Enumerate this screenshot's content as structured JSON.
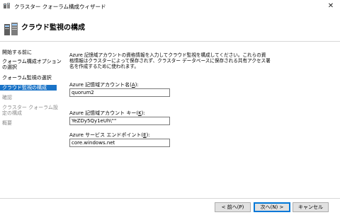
{
  "window": {
    "title": "クラスター クォーラム構成ウィザード",
    "close_glyph": "✕"
  },
  "banner": {
    "title": "クラウド監視の構成"
  },
  "nav": {
    "items": [
      {
        "label": "開始する前に",
        "state": "normal"
      },
      {
        "label": "クォーラム構成オプション",
        "label2": "の選択",
        "state": "normal"
      },
      {
        "label": "クォーラム監視の選択",
        "state": "normal"
      },
      {
        "label": "クラウド監視の構成",
        "state": "active"
      },
      {
        "label": "確認",
        "state": "disabled"
      },
      {
        "label": "クラスター クォーラム設",
        "label2": "定の構成",
        "state": "disabled"
      },
      {
        "label": "概要",
        "state": "disabled"
      }
    ]
  },
  "content": {
    "description_lines": [
      "Azure 記憶域アカウントの資格情報を入力してクラウド監視を構成してください。これらの資",
      "格情報はクラスターによって保存されず、クラスター データベースに保存される共有アクセス署",
      "名を作成するために使われます。"
    ],
    "fields": [
      {
        "label_pre": "Azure 記憶域アカウント名(",
        "accel": "A",
        "label_post": "):",
        "value": "quorum2"
      },
      {
        "label_pre": "Azure 記憶域アカウント キー(",
        "accel": "K",
        "label_post": "):",
        "value": "YeZDy5Qy1eUh\\\"\""
      },
      {
        "label_pre": "Azure サービス エンドポイント(",
        "accel": "E",
        "label_post": "):",
        "value": "core.windows.net"
      }
    ]
  },
  "footer": {
    "back_label": "< 前へ(P)",
    "next_label": "次へ(N) >",
    "cancel_label": "キャンセル"
  },
  "colors": {
    "nav_active_bg": "#1a73c7",
    "default_button_border": "#0078d7"
  }
}
